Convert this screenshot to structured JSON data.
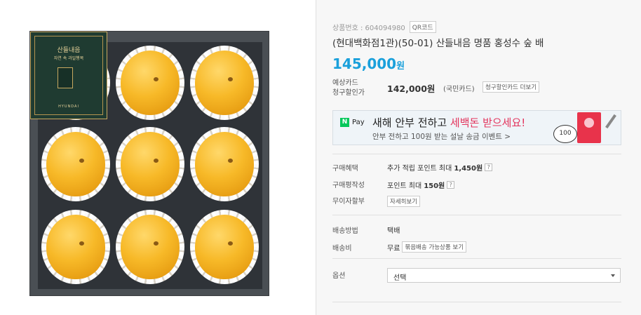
{
  "product": {
    "id_label": "상품번호 : 604094980",
    "qr_button": "QR코드",
    "title": "(현대백화점1관)(50-01) 산들내음 명품 홍성수 숲 배",
    "price": "145,000",
    "price_unit": "원"
  },
  "card": {
    "label_line1": "예상카드",
    "label_line2": "청구할인가",
    "price": "142,000원",
    "note": "(국민카드)",
    "more_button": "청구할인카드 더보기"
  },
  "banner": {
    "npay_n": "N",
    "npay_pay": "Pay",
    "main_prefix": "새해 안부 전하고 ",
    "main_highlight": "세백돈 받으세요!",
    "sub": "안부 전하고 100원 받는 설날 송금 이벤트 >",
    "coin_text": "100"
  },
  "benefits": {
    "purchase_label": "구매혜택",
    "purchase_prefix": "추가 적립 포인트 최대",
    "purchase_value": "1,450원",
    "review_label": "구매평작성",
    "review_prefix": "포인트 최대",
    "review_value": "150원",
    "qmark": "?",
    "installment_label": "무이자할부",
    "installment_button": "자세히보기"
  },
  "shipping": {
    "method_label": "배송방법",
    "method_value": "택배",
    "fee_label": "배송비",
    "fee_value": "무료",
    "bundle_button": "묶음배송 가능상품 보기"
  },
  "options": {
    "label": "옵션",
    "select_value": "선택"
  },
  "image": {
    "label_title": "산들내음",
    "label_subtitle": "자연 속 과일행복",
    "label_brand": "HYUNDAI"
  }
}
